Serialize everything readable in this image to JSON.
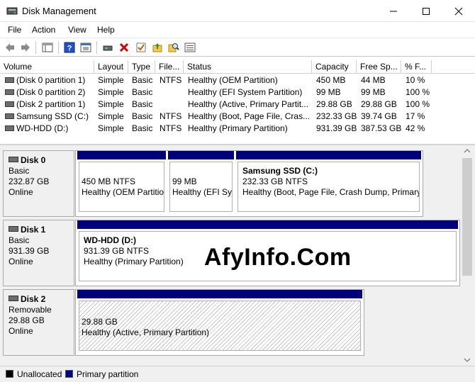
{
  "window": {
    "title": "Disk Management"
  },
  "menu": [
    "File",
    "Action",
    "View",
    "Help"
  ],
  "toolbar": {
    "icons": [
      "back-icon",
      "forward-icon",
      "properties-icon",
      "help-icon",
      "console-icon",
      "connect-icon",
      "delete-icon",
      "check-icon",
      "folder-up-icon",
      "search-icon",
      "list-icon"
    ]
  },
  "volumes": {
    "headers": [
      "Volume",
      "Layout",
      "Type",
      "File...",
      "Status",
      "Capacity",
      "Free Sp...",
      "% F..."
    ],
    "rows": [
      [
        "(Disk 0 partition 1)",
        "Simple",
        "Basic",
        "NTFS",
        "Healthy (OEM Partition)",
        "450 MB",
        "44 MB",
        "10 %"
      ],
      [
        "(Disk 0 partition 2)",
        "Simple",
        "Basic",
        "",
        "Healthy (EFI System Partition)",
        "99 MB",
        "99 MB",
        "100 %"
      ],
      [
        "(Disk 2 partition 1)",
        "Simple",
        "Basic",
        "",
        "Healthy (Active, Primary Partit...",
        "29.88 GB",
        "29.88 GB",
        "100 %"
      ],
      [
        "Samsung SSD (C:)",
        "Simple",
        "Basic",
        "NTFS",
        "Healthy (Boot, Page File, Cras...",
        "232.33 GB",
        "39.74 GB",
        "17 %"
      ],
      [
        "WD-HDD (D:)",
        "Simple",
        "Basic",
        "NTFS",
        "Healthy (Primary Partition)",
        "931.39 GB",
        "387.53 GB",
        "42 %"
      ]
    ]
  },
  "disks": [
    {
      "name": "Disk 0",
      "type": "Basic",
      "size": "232.87 GB",
      "status": "Online",
      "partitions": [
        {
          "name": "",
          "size": "450 MB NTFS",
          "status": "Healthy (OEM Partitio"
        },
        {
          "name": "",
          "size": "99 MB",
          "status": "Healthy (EFI Sys"
        },
        {
          "name": "Samsung SSD  (C:)",
          "size": "232.33 GB NTFS",
          "status": "Healthy (Boot, Page File, Crash Dump, Primary"
        }
      ]
    },
    {
      "name": "Disk 1",
      "type": "Basic",
      "size": "931.39 GB",
      "status": "Online",
      "partitions": [
        {
          "name": "WD-HDD  (D:)",
          "size": "931.39 GB NTFS",
          "status": "Healthy (Primary Partition)"
        }
      ]
    },
    {
      "name": "Disk 2",
      "type": "Removable",
      "size": "29.88 GB",
      "status": "Online",
      "partitions": [
        {
          "name": "",
          "size": "29.88 GB",
          "status": "Healthy (Active, Primary Partition)"
        }
      ]
    }
  ],
  "watermark": "AfyInfo.Com",
  "legend": {
    "unallocated": "Unallocated",
    "primary": "Primary partition"
  },
  "colors": {
    "primary_partition": "#00007f",
    "unallocated": "#000000"
  }
}
